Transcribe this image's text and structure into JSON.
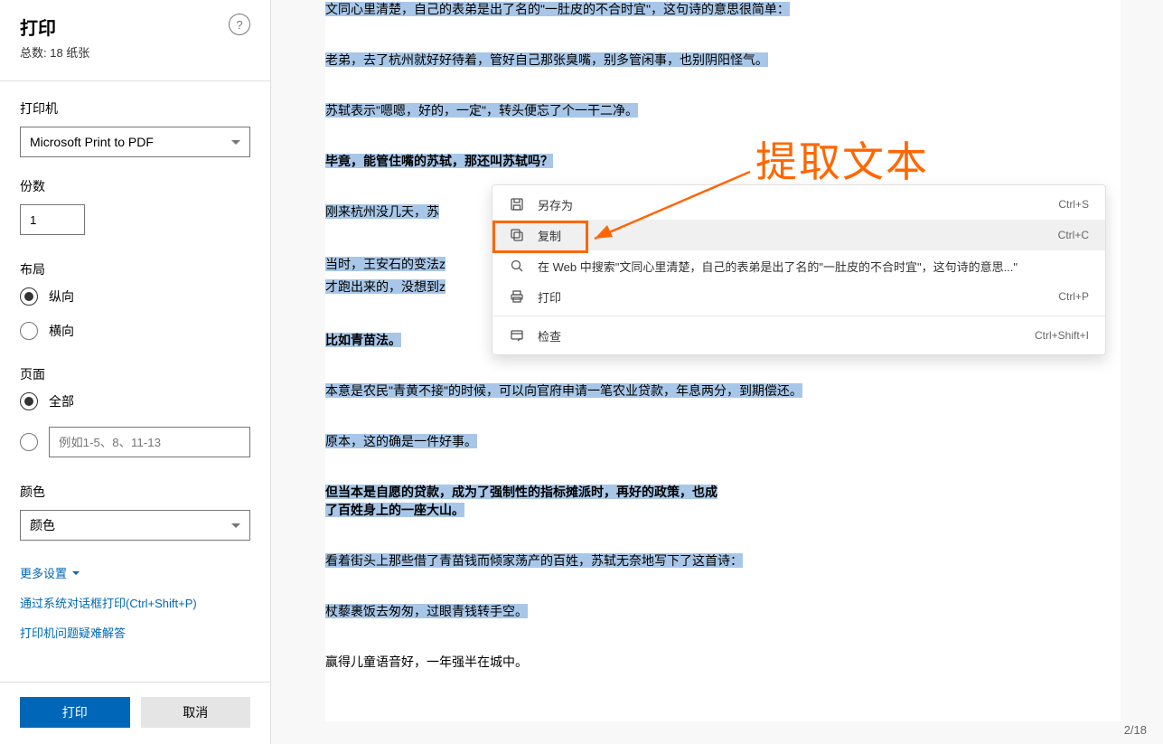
{
  "sidebar": {
    "title": "打印",
    "total": "总数: 18 纸张",
    "help": "?",
    "printer_label": "打印机",
    "printer_value": "Microsoft Print to PDF",
    "copies_label": "份数",
    "copies_value": "1",
    "layout_label": "布局",
    "layout_portrait": "纵向",
    "layout_landscape": "横向",
    "pages_label": "页面",
    "pages_all": "全部",
    "pages_custom_placeholder": "例如1-5、8、11-13",
    "color_label": "颜色",
    "color_value": "颜色",
    "more_settings": "更多设置",
    "system_dialog": "通过系统对话框打印(Ctrl+Shift+P)",
    "troubleshoot": "打印机问题疑难解答",
    "print_btn": "打印",
    "cancel_btn": "取消"
  },
  "content": {
    "lines": [
      {
        "text": "文同心里清楚，自己的表弟是出了名的\"一肚皮的不合时宜\"，这句诗的意思很简单：",
        "sel": true,
        "bold": false
      },
      {
        "text": "老弟，去了杭州就好好待着，管好自己那张臭嘴，别多管闲事，也别阴阳怪气。",
        "sel": true,
        "bold": false
      },
      {
        "text": "苏轼表示\"嗯嗯，好的，一定\"，转头便忘了个一干二净。",
        "sel": true,
        "bold": false
      },
      {
        "text": "毕竟，能管住嘴的苏轼，那还叫苏轼吗？",
        "sel": true,
        "bold": true,
        "truncate": 125
      },
      {
        "text": "刚来杭州没几天，苏",
        "sel": true,
        "bold": false,
        "truncate": 125
      },
      {
        "text": "当时，王安石的变法z",
        "sel": true,
        "bold": false,
        "second": "才跑出来的，没想到z",
        "truncate": 125
      },
      {
        "text": "比如青苗法。",
        "sel": true,
        "bold": true
      },
      {
        "text": "本意是农民\"青黄不接\"的时候，可以向官府申请一笔农业贷款，年息两分，到期偿还。",
        "sel": true,
        "bold": false
      },
      {
        "text": "原本，这的确是一件好事。",
        "sel": true,
        "bold": false
      },
      {
        "text": "但当本是自愿的贷款，成为了强制性的指标摊派时，再好的政策，也成了百姓身上的一座大山。",
        "sel": true,
        "bold": true,
        "wrap": true
      },
      {
        "text": "看着街头上那些借了青苗钱而倾家荡产的百姓，苏轼无奈地写下了这首诗：",
        "sel": true,
        "bold": false
      },
      {
        "text": "杖藜裹饭去匆匆，过眼青钱转手空。",
        "sel": true,
        "bold": false
      },
      {
        "text": "赢得儿童语音好，一年强半在城中。",
        "sel": false,
        "bold": false
      }
    ]
  },
  "context_menu": {
    "items": [
      {
        "icon": "save",
        "label": "另存为",
        "shortcut": "Ctrl+S"
      },
      {
        "icon": "copy",
        "label": "复制",
        "shortcut": "Ctrl+C",
        "hovered": true
      },
      {
        "icon": "search",
        "label": "在 Web 中搜索\"文同心里清楚，自己的表弟是出了名的\"一肚皮的不合时宜\"，这句诗的意思...\"",
        "shortcut": ""
      },
      {
        "icon": "print",
        "label": "打印",
        "shortcut": "Ctrl+P"
      },
      {
        "sep": true
      },
      {
        "icon": "inspect",
        "label": "检查",
        "shortcut": "Ctrl+Shift+I"
      }
    ]
  },
  "annotation": "提取文本",
  "page_counter": "2/18"
}
